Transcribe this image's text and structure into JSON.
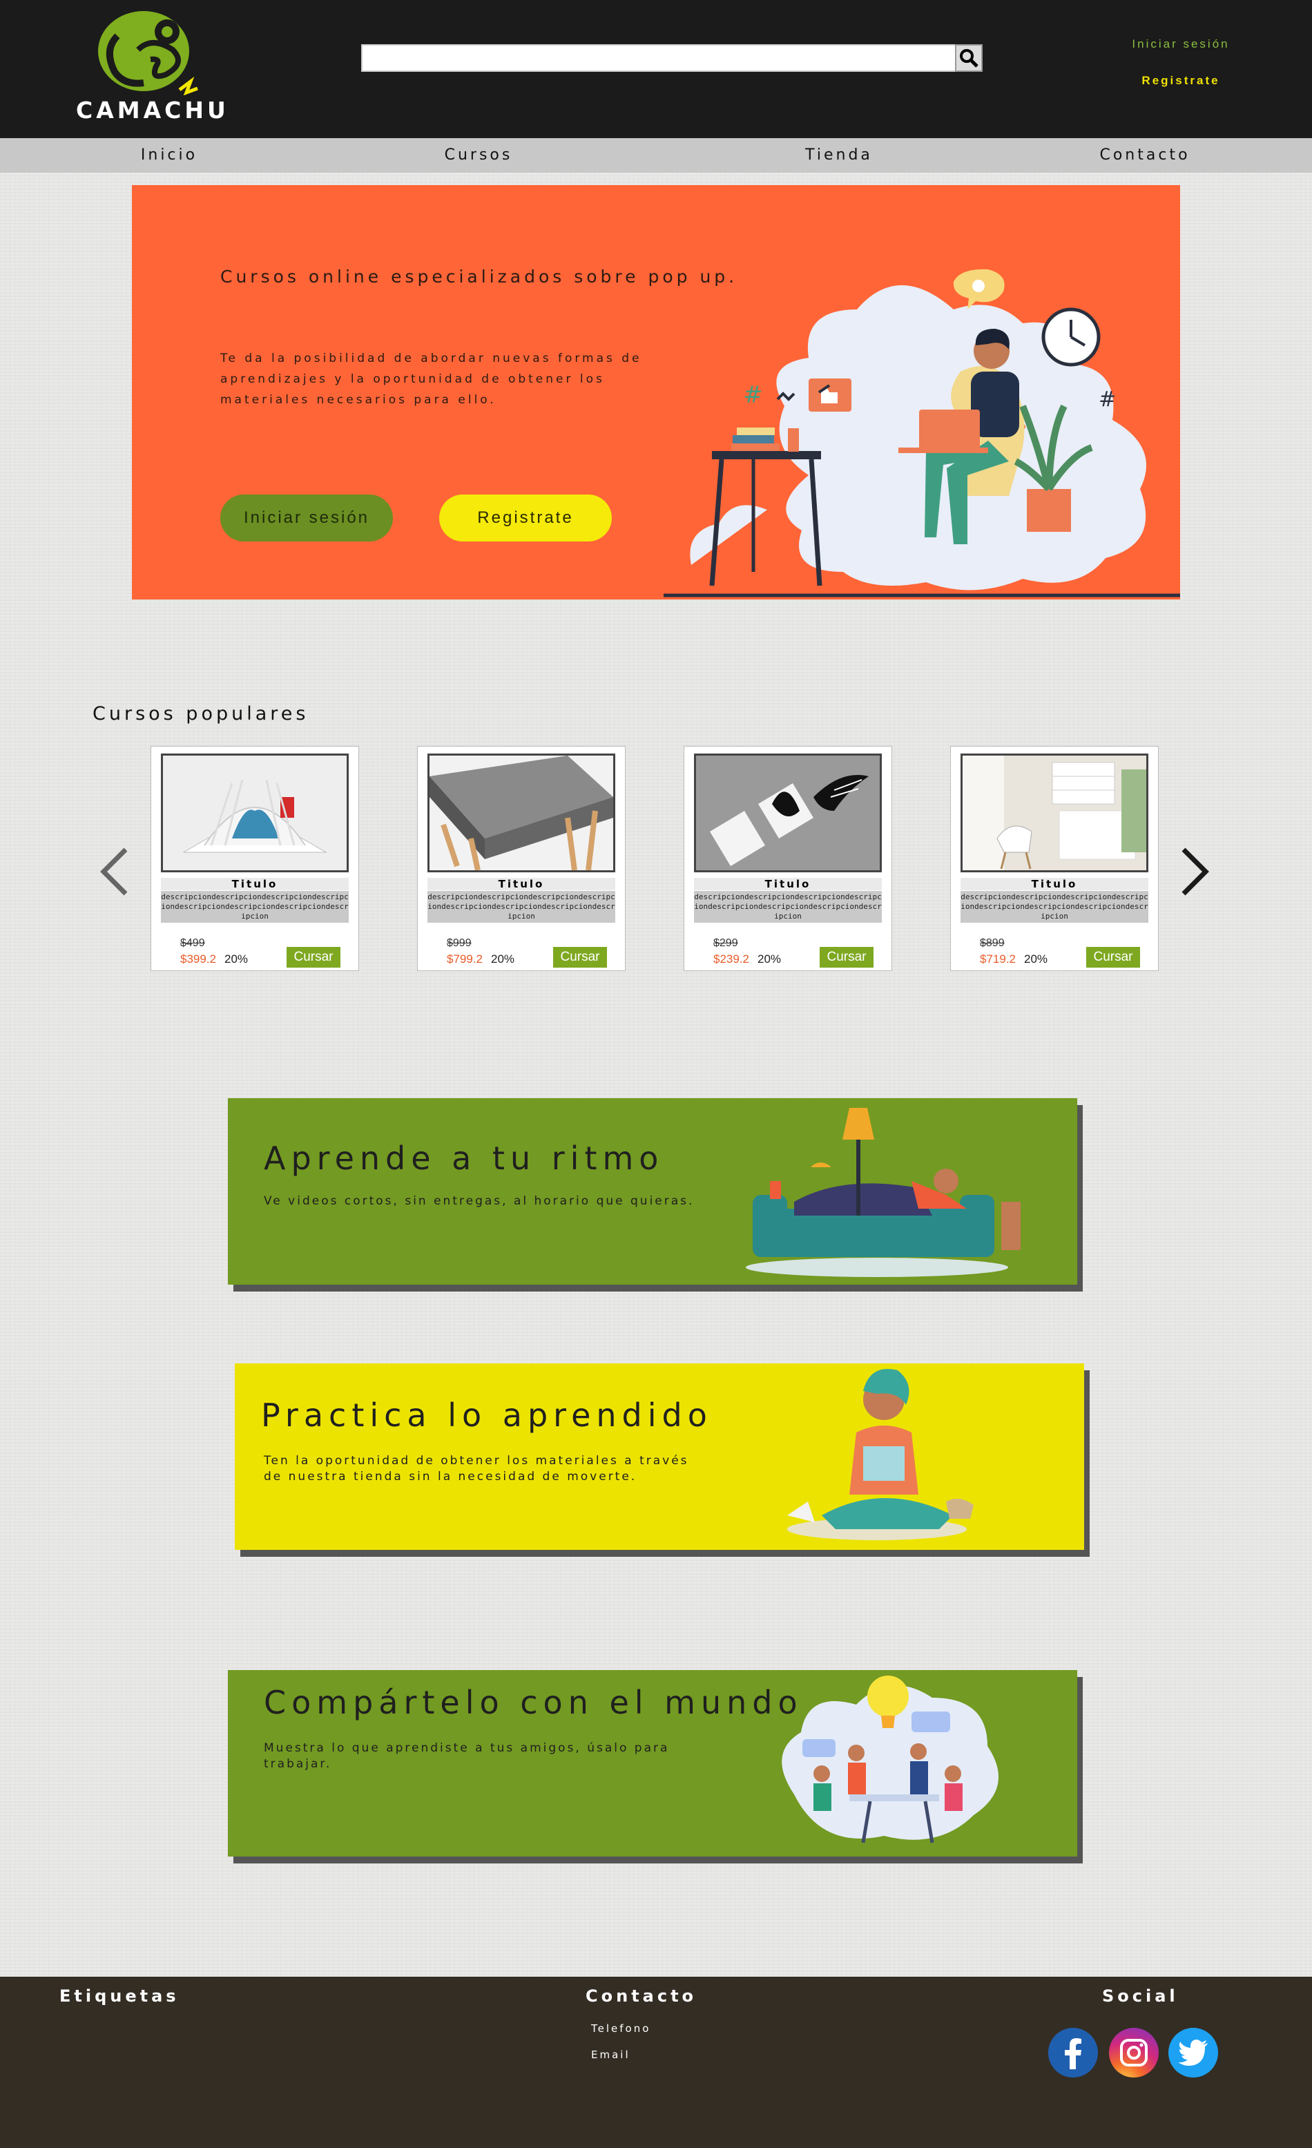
{
  "header": {
    "logo_text": "CAMACHU",
    "search_placeholder": "",
    "login_label": "Iniciar sesión",
    "register_label": "Registrate"
  },
  "nav": {
    "items": [
      {
        "label": "Inicio"
      },
      {
        "label": "Cursos"
      },
      {
        "label": "Tienda"
      },
      {
        "label": "Contacto"
      }
    ]
  },
  "hero": {
    "title": "Cursos online especializados sobre pop up.",
    "description": "Te da la posibilidad de abordar nuevas formas de aprendizajes y la oportunidad de obtener los materiales necesarios para ello.",
    "login_button": "Iniciar sesión",
    "register_button": "Registrate"
  },
  "popular": {
    "title": "Cursos populares",
    "cards": [
      {
        "title": "Titulo",
        "description": "descripciondescripciondescripciondescripciondescripciondescripciondescripciondescripcion",
        "old_price": "$499",
        "new_price": "$399.2",
        "discount": "20%",
        "button": "Cursar"
      },
      {
        "title": "Titulo",
        "description": "descripciondescripciondescripciondescripciondescripciondescripciondescripciondescripcion",
        "old_price": "$999",
        "new_price": "$799.2",
        "discount": "20%",
        "button": "Cursar"
      },
      {
        "title": "Titulo",
        "description": "descripciondescripciondescripciondescripciondescripciondescripciondescripciondescripcion",
        "old_price": "$299",
        "new_price": "$239.2",
        "discount": "20%",
        "button": "Cursar"
      },
      {
        "title": "Titulo",
        "description": "descripciondescripciondescripciondescripciondescripciondescripciondescripciondescripcion",
        "old_price": "$899",
        "new_price": "$719.2",
        "discount": "20%",
        "button": "Cursar"
      }
    ]
  },
  "features": [
    {
      "title": "Aprende a tu ritmo",
      "text": "Ve videos cortos, sin entregas, al horario que quieras."
    },
    {
      "title": "Practica lo aprendido",
      "text": "Ten la oportunidad de obtener los materiales a través de nuestra tienda sin la necesidad de moverte."
    },
    {
      "title": "Compártelo con el mundo",
      "text": "Muestra lo que aprendiste a tus amigos, úsalo para trabajar."
    }
  ],
  "footer": {
    "tags_heading": "Etiquetas",
    "contact_heading": "Contacto",
    "phone_label": "Telefono",
    "email_label": "Email",
    "social_heading": "Social"
  },
  "colors": {
    "header_bg": "#1b1b1b",
    "nav_bg": "#c8c8c8",
    "hero_bg": "#ff6537",
    "green": "#739a22",
    "yellow": "#ece400",
    "footer_bg": "#342d24"
  },
  "icons": [
    "chameleon-logo-icon",
    "search-icon",
    "chevron-left-icon",
    "chevron-right-icon",
    "facebook-icon",
    "instagram-icon",
    "twitter-icon"
  ]
}
